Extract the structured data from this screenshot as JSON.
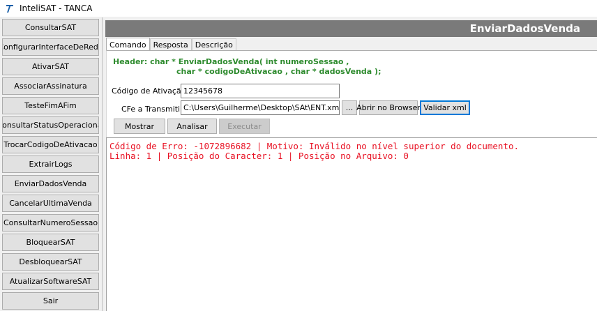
{
  "window": {
    "title": "InteliSAT - TANCA"
  },
  "sidebar": {
    "items": [
      "ConsultarSAT",
      "ConfigurarInterfaceDeRede",
      "AtivarSAT",
      "AssociarAssinatura",
      "TesteFimAFim",
      "ConsultarStatusOperacional",
      "TrocarCodigoDeAtivacao",
      "ExtrairLogs",
      "EnviarDadosVenda",
      "CancelarUltimaVenda",
      "ConsultarNumeroSessao",
      "BloquearSAT",
      "DesbloquearSAT",
      "AtualizarSoftwareSAT",
      "Sair"
    ]
  },
  "header": {
    "title": "EnviarDadosVenda"
  },
  "tabs": [
    "Comando",
    "Resposta",
    "Descrição"
  ],
  "signature": {
    "line1": "Header: char * EnviarDadosVenda( int numeroSessao ,",
    "line2": "char * codigoDeAtivacao , char * dadosVenda );"
  },
  "form": {
    "codigo_label": "Código de Ativação:",
    "codigo_value": "12345678",
    "cfe_label": "CFe a Transmitir:",
    "cfe_value": "C:\\Users\\Guilherme\\Desktop\\SAt\\ENT.xml",
    "browse_label": "...",
    "abrir_label": "Abrir no Browser",
    "validar_label": "Validar xml",
    "mostrar_label": "Mostrar",
    "analisar_label": "Analisar",
    "executar_label": "Executar"
  },
  "output": {
    "line1": "Código de Erro: -1072896682 | Motivo: Inválido no nível superior do documento.",
    "line2": "Linha: 1 | Posição do Caracter: 1 | Posição no Arquivo: 0"
  },
  "colors": {
    "header_bg": "#7a7a7a",
    "signature": "#2e8b2e",
    "error": "#e81123",
    "accent": "#0078d7"
  }
}
